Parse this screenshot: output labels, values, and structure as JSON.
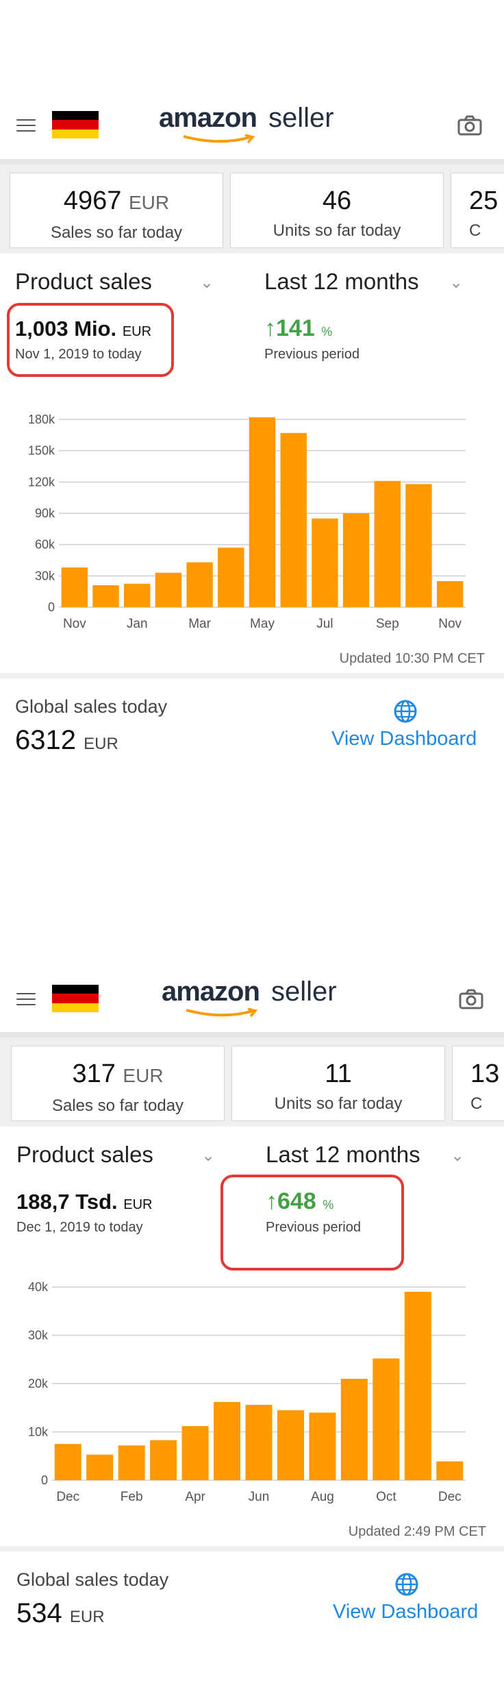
{
  "colors": {
    "bar": "#ff9900",
    "growth": "#43a047",
    "link": "#1e88e5",
    "highlight": "#e53935"
  },
  "screens": [
    {
      "header": {
        "logo_amazon": "amazon",
        "logo_seller": "seller",
        "flag": "germany-flag",
        "menu_icon": "hamburger-menu-icon",
        "camera_icon": "camera-icon"
      },
      "cards": [
        {
          "value": "4967",
          "unit": "EUR",
          "label": "Sales so far today"
        },
        {
          "value": "46",
          "unit": "",
          "label": "Units so far today"
        },
        {
          "value": "25",
          "unit": "",
          "label": "C"
        }
      ],
      "metric_dropdown": "Product sales",
      "period_dropdown": "Last 12 months",
      "total_value": "1,003 Mio.",
      "total_unit": "EUR",
      "total_range": "Nov 1, 2019 to today",
      "growth_value": "141",
      "growth_unit": "%",
      "growth_label": "Previous period",
      "updated": "Updated 10:30 PM CET",
      "global_label": "Global sales today",
      "global_value": "6312",
      "global_unit": "EUR",
      "view_dashboard": "View Dashboard"
    },
    {
      "header": {
        "logo_amazon": "amazon",
        "logo_seller": "seller",
        "flag": "germany-flag",
        "menu_icon": "hamburger-menu-icon",
        "camera_icon": "camera-icon"
      },
      "cards": [
        {
          "value": "317",
          "unit": "EUR",
          "label": "Sales so far today"
        },
        {
          "value": "11",
          "unit": "",
          "label": "Units so far today"
        },
        {
          "value": "13",
          "unit": "",
          "label": "C"
        }
      ],
      "metric_dropdown": "Product sales",
      "period_dropdown": "Last 12 months",
      "total_value": "188,7 Tsd.",
      "total_unit": "EUR",
      "total_range": "Dec 1, 2019 to today",
      "growth_value": "648",
      "growth_unit": "%",
      "growth_label": "Previous period",
      "updated": "Updated 2:49 PM CET",
      "global_label": "Global sales today",
      "global_value": "534",
      "global_unit": "EUR",
      "view_dashboard": "View Dashboard"
    }
  ],
  "chart_data": [
    {
      "type": "bar",
      "categories": [
        "Nov",
        "Dec",
        "Jan",
        "Feb",
        "Mar",
        "Apr",
        "May",
        "Jun",
        "Jul",
        "Aug",
        "Sep",
        "Oct",
        "Nov"
      ],
      "tick_labels_x": [
        "Nov",
        "",
        "Jan",
        "",
        "Mar",
        "",
        "May",
        "",
        "Jul",
        "",
        "Sep",
        "",
        "Nov"
      ],
      "values": [
        38000,
        21000,
        22500,
        33000,
        43000,
        57000,
        182000,
        167000,
        85000,
        90000,
        121000,
        118000,
        25000
      ],
      "y_ticks": [
        "0",
        "30k",
        "60k",
        "90k",
        "120k",
        "150k",
        "180k"
      ],
      "ylim": [
        0,
        180000
      ],
      "grid": true
    },
    {
      "type": "bar",
      "categories": [
        "Dec",
        "Jan",
        "Feb",
        "Mar",
        "Apr",
        "May",
        "Jun",
        "Jul",
        "Aug",
        "Sep",
        "Oct",
        "Nov",
        "Dec"
      ],
      "tick_labels_x": [
        "Dec",
        "",
        "Feb",
        "",
        "Apr",
        "",
        "Jun",
        "",
        "Aug",
        "",
        "Oct",
        "",
        "Dec"
      ],
      "values": [
        7500,
        5300,
        7200,
        8300,
        11200,
        16200,
        15600,
        14500,
        14000,
        21000,
        25200,
        39000,
        3900
      ],
      "y_ticks": [
        "0",
        "10k",
        "20k",
        "30k",
        "40k"
      ],
      "ylim": [
        0,
        40000
      ],
      "grid": true
    }
  ]
}
